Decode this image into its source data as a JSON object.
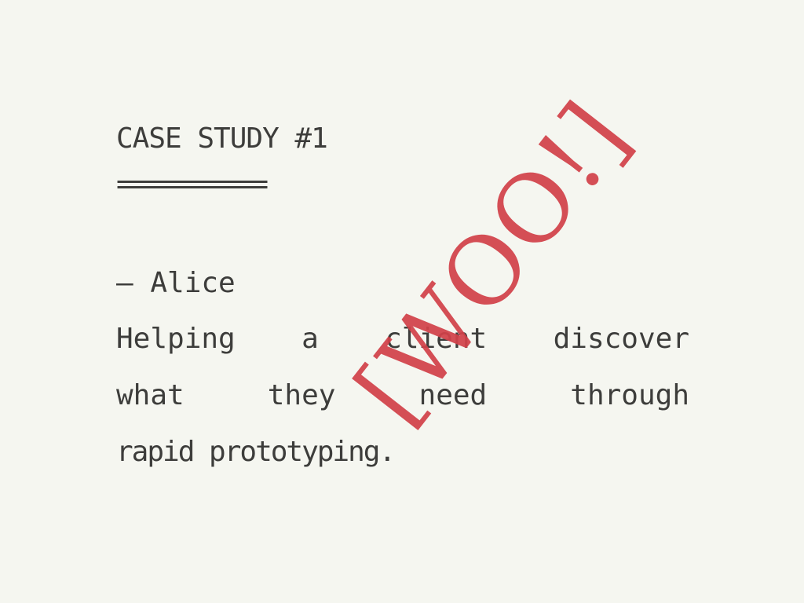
{
  "document": {
    "title": "CASE STUDY #1",
    "title_underline": "============",
    "author": "— Alice",
    "body_lines": [
      "Helping a client discover",
      "what they need through",
      "rapid prototyping."
    ]
  },
  "stamp": {
    "text": "[WOO!]",
    "color": "#d2424a"
  },
  "colors": {
    "background": "#f5f6f0",
    "text": "#3d3d3b"
  }
}
